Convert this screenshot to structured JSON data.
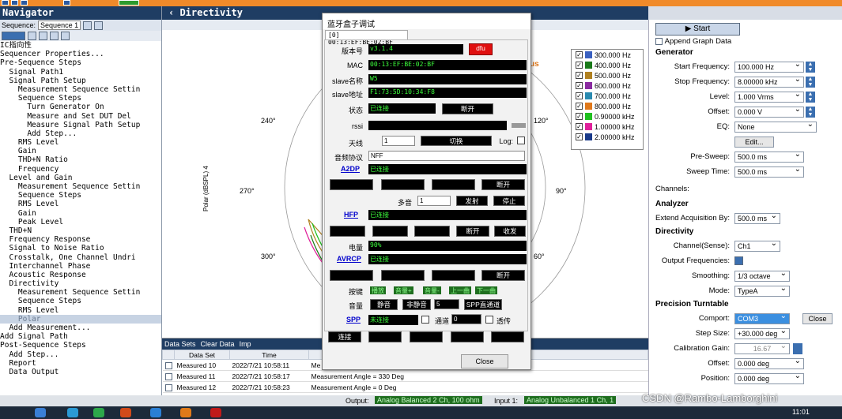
{
  "nav": {
    "title": "Navigator",
    "seq_label": "Sequence:",
    "seq_value": "Sequence 1",
    "tree": [
      "IC指向性",
      "Sequencer Properties...",
      "Pre-Sequence Steps",
      "  Signal Path1",
      "  Signal Path Setup",
      "    Measurement Sequence Settin",
      "    Sequence Steps",
      "      Turn Generator On",
      "      Measure and Set DUT Del",
      "      Measure Signal Path Setup",
      "      Add Step...",
      "    RMS Level",
      "    Gain",
      "    THD+N Ratio",
      "    Frequency",
      "  Level and Gain",
      "    Measurement Sequence Settin",
      "    Sequence Steps",
      "    RMS Level",
      "    Gain",
      "    Peak Level",
      "  THD+N",
      "  Frequency Response",
      "  Signal to Noise Ratio",
      "  Crosstalk, One Channel Undri",
      "  Interchannel Phase",
      "  Acoustic Response",
      "  Directivity",
      "    Measurement Sequence Settin",
      "    Sequence Steps",
      "    RMS Level",
      "    Polar",
      "  Add Measurement...",
      "Add Signal Path",
      "Post-Sequence Steps",
      "  Add Step...",
      "  Report",
      "  Data Output"
    ]
  },
  "mid": {
    "title": "Directivity",
    "y_axis": "Polar (dBSPL) 4",
    "angles": {
      "a240": "240°",
      "a270": "270°",
      "a300": "300°",
      "a90": "90°",
      "a120": "120°",
      "a60": "60°"
    },
    "fragment": "us"
  },
  "legend": [
    {
      "label": "300.000 Hz",
      "color": "#3a60c0"
    },
    {
      "label": "400.000 Hz",
      "color": "#1a7a1a"
    },
    {
      "label": "500.000 Hz",
      "color": "#b08020"
    },
    {
      "label": "600.000 Hz",
      "color": "#8a2aa0"
    },
    {
      "label": "700.000 Hz",
      "color": "#2a8ab0"
    },
    {
      "label": "800.000 Hz",
      "color": "#e0781a"
    },
    {
      "label": "0.90000 kHz",
      "color": "#20c020"
    },
    {
      "label": "1.00000 kHz",
      "color": "#e0209a"
    },
    {
      "label": "2.00000 kHz",
      "color": "#1a3a8a"
    }
  ],
  "datasets": {
    "title": "Data Sets",
    "clear": "Clear Data",
    "imp": "Imp",
    "col1": "Data Set",
    "col2": "Time",
    "rows": [
      {
        "name": "Measured 10",
        "time": "2022/7/21 10:58:11",
        "desc": "Me"
      },
      {
        "name": "Measured 11",
        "time": "2022/7/21 10:58:17",
        "desc": "Measurement Angle = 330 Deg"
      },
      {
        "name": "Measured 12",
        "time": "2022/7/21 10:58:23",
        "desc": "Measurement Angle = 0 Deg"
      }
    ]
  },
  "right": {
    "start": "Start",
    "append": "Append Graph Data",
    "generator": "Generator",
    "start_freq_l": "Start Frequency:",
    "start_freq": "100.000 Hz",
    "stop_freq_l": "Stop Frequency:",
    "stop_freq": "8.00000 kHz",
    "level_l": "Level:",
    "level": "1.000 Vrms",
    "offset_l": "Offset:",
    "offset": "0.000 V",
    "eq_l": "EQ:",
    "eq": "None",
    "edit": "Edit...",
    "presweep_l": "Pre-Sweep:",
    "presweep": "500.0 ms",
    "sweep_l": "Sweep Time:",
    "sweep": "500.0 ms",
    "channels": "Channels:",
    "analyzer": "Analyzer",
    "extend_l": "Extend Acquisition By:",
    "extend": "500.0 ms",
    "directivity": "Directivity",
    "chsense_l": "Channel(Sense):",
    "chsense": "Ch1",
    "outfreq_l": "Output Frequencies:",
    "smooth_l": "Smoothing:",
    "smooth": "1/3 octave",
    "mode_l": "Mode:",
    "mode": "TypeA",
    "turntable": "Precision Turntable",
    "comport_l": "Comport:",
    "comport": "COM3",
    "close": "Close",
    "step_l": "Step Size:",
    "step": "+30.000 deg",
    "calib_l": "Calibration Gain:",
    "calib": "16.67",
    "off2_l": "Offset:",
    "off2": "0.000 deg",
    "pos_l": "Position:",
    "pos": "0.000 deg"
  },
  "dlg": {
    "title": "蓝牙盒子调试",
    "tab": "[0] 00:13:EF:BE:02:BF",
    "ver_l": "版本号",
    "ver": "v3.1.4",
    "dfu": "dfu",
    "mac_l": "MAC",
    "mac": "00:13:EF:BE:02:BF",
    "sname_l": "slave名称",
    "sname": "W5",
    "saddr_l": "slave地址",
    "saddr": "F1:73:5D:10:34:F8",
    "state_l": "状态",
    "state": "已连接",
    "disc": "断开",
    "rssi_l": "rssi",
    "ant_l": "天线",
    "ant": "1",
    "switch": "切换",
    "log": "Log:",
    "codec_l": "音频协议",
    "codec": "NFF",
    "a2dp": "A2DP",
    "a2dp_s": "已连接",
    "multi_l": "多音",
    "multi_v": "1",
    "send": "发射",
    "stop": "停止",
    "hfp": "HFP",
    "hfp_s": "已连接",
    "recv": "收发",
    "batt_l": "电量",
    "batt": "90%",
    "avrcp": "AVRCP",
    "avrcp_s": "已连接",
    "key_l": "按键",
    "keys": [
      "播放",
      "音量+",
      "音量-",
      "上一曲",
      "下一曲"
    ],
    "vol_l": "音量",
    "mute": "静音",
    "unmute": "非静音",
    "vol": "5",
    "spp_ch": "SPP直通道",
    "spp": "SPP",
    "spp_s": "未连接",
    "ch": "通道",
    "ch_v": "0",
    "pass": "透传",
    "connect": "连接",
    "closebtn": "Close"
  },
  "status": {
    "output_l": "Output:",
    "output": "Analog Balanced 2 Ch, 100 ohm",
    "input_l": "Input 1:",
    "input": "Analog Unbalanced 1 Ch, 1",
    "watermark": "CSDN @Rambo-Lamborghini",
    "time": "11:01"
  }
}
